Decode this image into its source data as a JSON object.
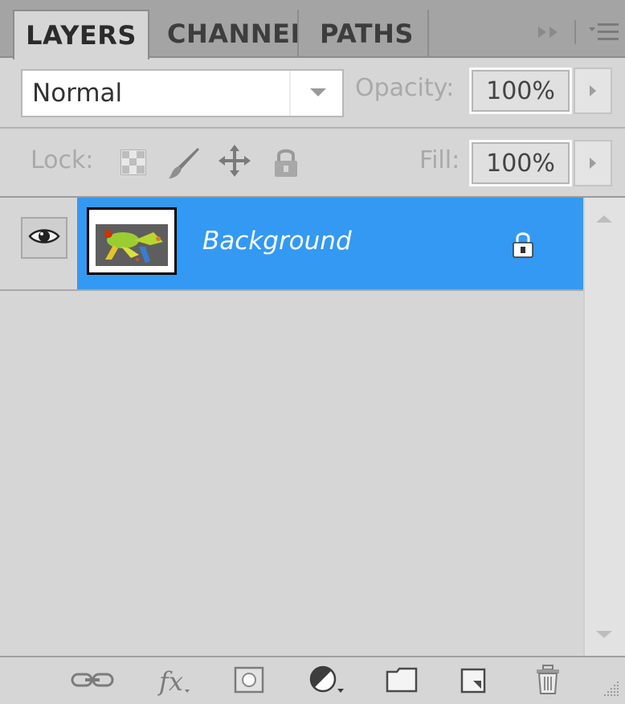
{
  "tabs": [
    {
      "label": "LAYERS",
      "active": true
    },
    {
      "label": "CHANNEL"
    },
    {
      "label": "PATHS"
    }
  ],
  "blend": {
    "mode": "Normal",
    "opacity_label": "Opacity:",
    "opacity_value": "100%"
  },
  "lock": {
    "label": "Lock:",
    "fill_label": "Fill:",
    "fill_value": "100%"
  },
  "layers": [
    {
      "name": "Background",
      "visible": true,
      "selected": true,
      "locked": true
    }
  ],
  "colors": {
    "selection": "#3399f3",
    "panel": "#d6d6d6",
    "tabbar": "#a4a4a4"
  },
  "footer_icons": [
    "link-layers-icon",
    "fx-icon",
    "layer-mask-icon",
    "adjustment-layer-icon",
    "new-group-icon",
    "new-layer-icon",
    "delete-layer-icon"
  ]
}
